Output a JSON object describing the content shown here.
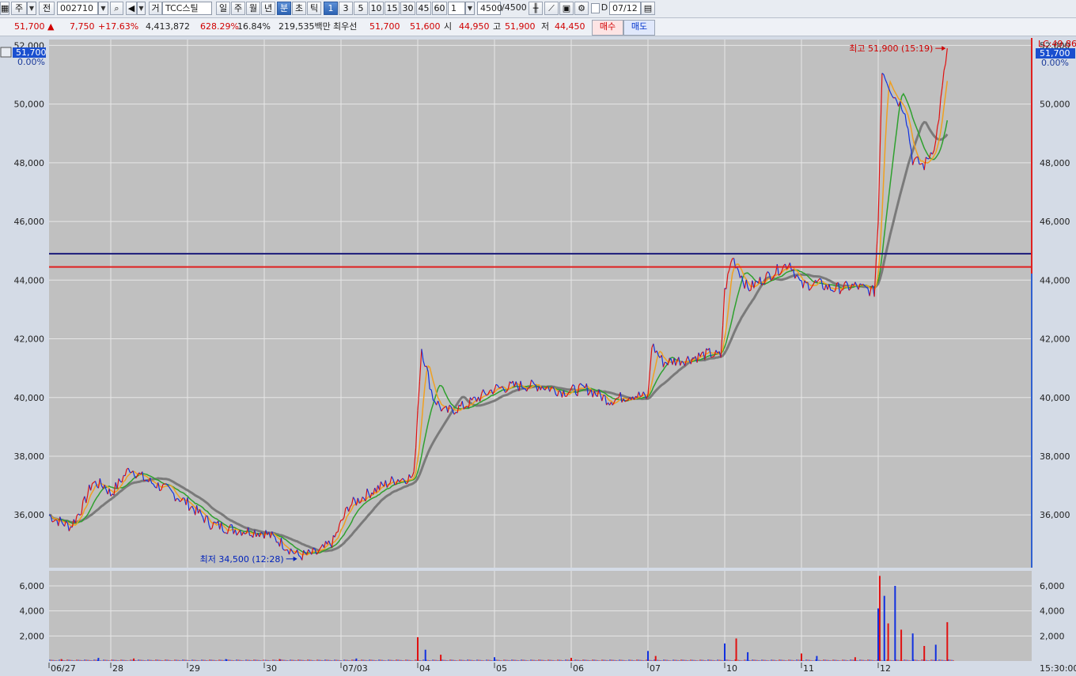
{
  "toolbar": {
    "market": "주",
    "kind": "전",
    "code": "002710",
    "name_prefix": "거",
    "name": "TCC스틸",
    "periods": [
      "일",
      "주",
      "월",
      "년",
      "분",
      "초",
      "틱"
    ],
    "intervals": [
      "1",
      "3",
      "5",
      "10",
      "15",
      "30",
      "45",
      "60"
    ],
    "multiplier": "1",
    "count": "4500",
    "count_total": "/4500",
    "date": "07/12"
  },
  "quote": {
    "price": "51,700",
    "change_arrow": "▲",
    "change": "7,750",
    "change_pct": "+17.63%",
    "volume": "4,413,872",
    "volume_ratio": "628.29%",
    "turnover": "16.84%",
    "amount": "219,535백만",
    "best_label": "최우선",
    "ask": "51,700",
    "bid": "51,600",
    "open_label": "시",
    "open": "44,950",
    "high_label": "고",
    "high": "51,900",
    "low_label": "저",
    "low": "44,450",
    "buy_label": "매수",
    "sell_label": "매도"
  },
  "panel": {
    "left_price": "51,700",
    "left_pct": "0.00%",
    "right_price": "51,700",
    "right_pct": "0.00%",
    "lc_label": "LC:49.86",
    "time_label": "15:30:00"
  },
  "chart_data": {
    "type": "line",
    "x_label": "",
    "y_label": "",
    "x_ticks": [
      "06/27",
      "28",
      "29",
      "30",
      "07/03",
      "04",
      "05",
      "06",
      "07",
      "10",
      "11",
      "12"
    ],
    "y_ticks": [
      36000,
      38000,
      40000,
      42000,
      44000,
      46000,
      48000,
      50000,
      52000
    ],
    "y_tick_labels": [
      "36,000",
      "38,000",
      "40,000",
      "42,000",
      "44,000",
      "46,000",
      "48,000",
      "50,000",
      "52,000"
    ],
    "ylim": [
      34200,
      52200
    ],
    "volume_ticks": [
      2000,
      4000,
      6000
    ],
    "volume_tick_labels": [
      "2,000",
      "4,000",
      "6,000"
    ],
    "volume_ylim": [
      0,
      7200
    ],
    "grid": true,
    "horizontal_lines": [
      {
        "value": 44900,
        "color": "#1a1a7a"
      },
      {
        "value": 44450,
        "color": "#e02020"
      }
    ],
    "annotations": {
      "high": {
        "text": "최고 51,900 (15:19)",
        "day": 11.9,
        "value": 51900
      },
      "low": {
        "text": "최저 34,500 (12:28)",
        "day": 3.45,
        "value": 34500
      }
    },
    "price_path": [
      {
        "day": 0.0,
        "value": 36000
      },
      {
        "day": 0.1,
        "value": 35850
      },
      {
        "day": 0.35,
        "value": 35600
      },
      {
        "day": 0.55,
        "value": 36300
      },
      {
        "day": 0.7,
        "value": 37100
      },
      {
        "day": 0.9,
        "value": 37000
      },
      {
        "day": 1.0,
        "value": 36700
      },
      {
        "day": 1.25,
        "value": 37600
      },
      {
        "day": 1.45,
        "value": 37200
      },
      {
        "day": 1.7,
        "value": 36900
      },
      {
        "day": 2.0,
        "value": 36400
      },
      {
        "day": 2.3,
        "value": 35700
      },
      {
        "day": 2.6,
        "value": 35500
      },
      {
        "day": 3.0,
        "value": 35400
      },
      {
        "day": 3.2,
        "value": 35100
      },
      {
        "day": 3.45,
        "value": 34600
      },
      {
        "day": 3.7,
        "value": 34700
      },
      {
        "day": 3.9,
        "value": 35100
      },
      {
        "day": 4.1,
        "value": 36300
      },
      {
        "day": 4.4,
        "value": 36800
      },
      {
        "day": 4.7,
        "value": 37200
      },
      {
        "day": 4.95,
        "value": 37300
      },
      {
        "day": 5.0,
        "value": 39600
      },
      {
        "day": 5.05,
        "value": 41700
      },
      {
        "day": 5.2,
        "value": 40000
      },
      {
        "day": 5.35,
        "value": 39500
      },
      {
        "day": 5.6,
        "value": 39700
      },
      {
        "day": 6.0,
        "value": 40300
      },
      {
        "day": 6.3,
        "value": 40400
      },
      {
        "day": 6.6,
        "value": 40400
      },
      {
        "day": 6.9,
        "value": 40200
      },
      {
        "day": 7.2,
        "value": 40300
      },
      {
        "day": 7.5,
        "value": 39900
      },
      {
        "day": 7.8,
        "value": 40100
      },
      {
        "day": 8.0,
        "value": 40000
      },
      {
        "day": 8.05,
        "value": 41800
      },
      {
        "day": 8.2,
        "value": 41200
      },
      {
        "day": 8.5,
        "value": 41300
      },
      {
        "day": 8.8,
        "value": 41500
      },
      {
        "day": 8.95,
        "value": 41400
      },
      {
        "day": 9.0,
        "value": 43600
      },
      {
        "day": 9.1,
        "value": 44800
      },
      {
        "day": 9.3,
        "value": 43700
      },
      {
        "day": 9.6,
        "value": 44200
      },
      {
        "day": 9.85,
        "value": 44600
      },
      {
        "day": 10.0,
        "value": 43800
      },
      {
        "day": 10.2,
        "value": 43900
      },
      {
        "day": 10.4,
        "value": 43700
      },
      {
        "day": 10.7,
        "value": 43800
      },
      {
        "day": 10.95,
        "value": 43600
      },
      {
        "day": 11.0,
        "value": 46000
      },
      {
        "day": 11.05,
        "value": 51200
      },
      {
        "day": 11.2,
        "value": 50300
      },
      {
        "day": 11.35,
        "value": 49800
      },
      {
        "day": 11.45,
        "value": 48100
      },
      {
        "day": 11.6,
        "value": 47900
      },
      {
        "day": 11.75,
        "value": 48700
      },
      {
        "day": 11.9,
        "value": 51900
      }
    ],
    "volume_bars": [
      {
        "day": 0.2,
        "value": 150
      },
      {
        "day": 0.8,
        "value": 250
      },
      {
        "day": 1.3,
        "value": 200
      },
      {
        "day": 2.5,
        "value": 150
      },
      {
        "day": 3.2,
        "value": 150
      },
      {
        "day": 4.2,
        "value": 200
      },
      {
        "day": 5.0,
        "value": 1900
      },
      {
        "day": 5.1,
        "value": 900
      },
      {
        "day": 5.3,
        "value": 500
      },
      {
        "day": 6.0,
        "value": 300
      },
      {
        "day": 7.0,
        "value": 250
      },
      {
        "day": 8.0,
        "value": 800
      },
      {
        "day": 8.1,
        "value": 400
      },
      {
        "day": 9.0,
        "value": 1400
      },
      {
        "day": 9.15,
        "value": 1800
      },
      {
        "day": 9.3,
        "value": 700
      },
      {
        "day": 10.0,
        "value": 600
      },
      {
        "day": 10.2,
        "value": 400
      },
      {
        "day": 10.7,
        "value": 300
      },
      {
        "day": 11.0,
        "value": 4200
      },
      {
        "day": 11.02,
        "value": 6800
      },
      {
        "day": 11.08,
        "value": 5200
      },
      {
        "day": 11.13,
        "value": 3000
      },
      {
        "day": 11.22,
        "value": 6000
      },
      {
        "day": 11.3,
        "value": 2500
      },
      {
        "day": 11.45,
        "value": 2200
      },
      {
        "day": 11.6,
        "value": 1200
      },
      {
        "day": 11.75,
        "value": 1300
      },
      {
        "day": 11.9,
        "value": 3100
      }
    ]
  }
}
